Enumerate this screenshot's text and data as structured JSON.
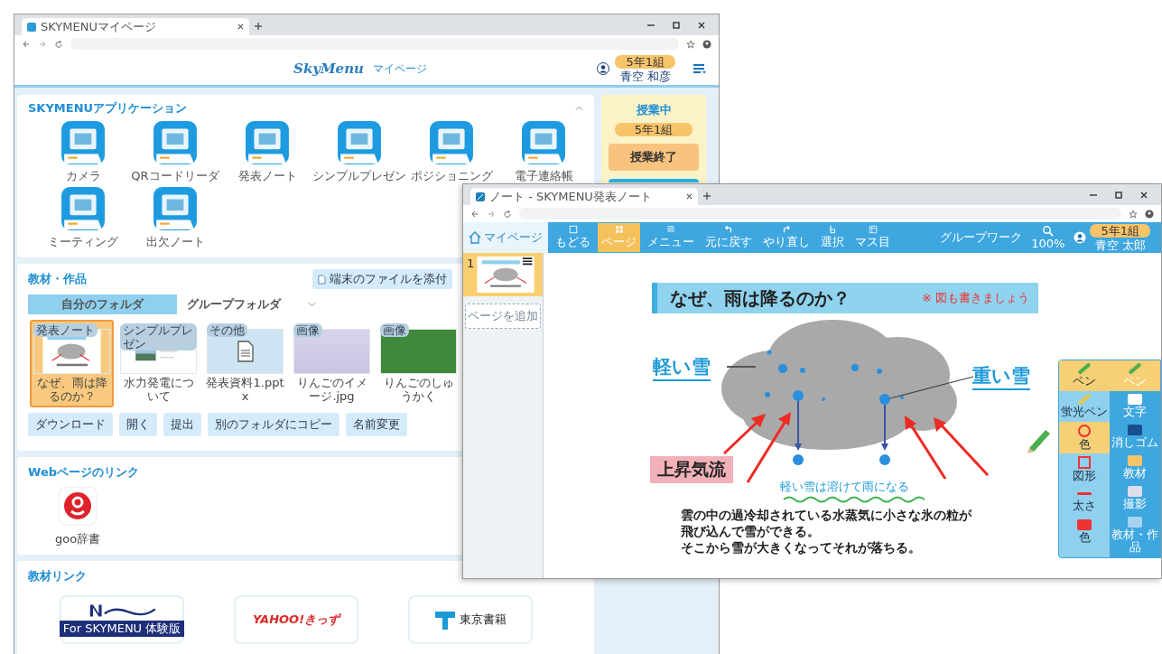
{
  "main_window": {
    "tab_title": "SKYMENUマイページ",
    "logo": "SkyMenu",
    "header_title": "マイページ",
    "class_badge": "5年1組",
    "user_name": "青空 和彦",
    "apps_section": {
      "title": "SKYMENUアプリケーション",
      "apps": [
        "カメラ",
        "QRコードリーダ",
        "発表ノート",
        "シンプルプレゼン",
        "ポジショニング",
        "電子連絡帳",
        "ミーティング",
        "出欠ノート"
      ]
    },
    "class_panel": {
      "status": "授業中",
      "class_badge": "5年1組",
      "end_button": "授業終了"
    },
    "materials": {
      "title": "教材・作品",
      "attach_button": "端末のファイルを添付",
      "folder_tabs": [
        {
          "label": "自分のフォルダ",
          "selected": true
        },
        {
          "label": "グループフォルダ",
          "selected": false
        }
      ],
      "files": [
        {
          "kind": "note",
          "tag": "発表ノート",
          "name": "なぜ、雨は降るのか？",
          "selected": true
        },
        {
          "kind": "presentation",
          "tag": "シンプルプレゼン",
          "name": "水力発電について",
          "selected": false
        },
        {
          "kind": "document",
          "tag": "その他",
          "name": "発表資料1.pptx",
          "selected": false
        },
        {
          "kind": "photo",
          "tag": "画像",
          "name": "りんごのイメージ.jpg",
          "selected": false
        },
        {
          "kind": "photo",
          "tag": "画像",
          "name": "りんごのしゅうかく",
          "selected": false
        }
      ],
      "actions": [
        "ダウンロード",
        "開く",
        "提出",
        "別のフォルダにコピー",
        "名前変更"
      ]
    },
    "web_links": {
      "title": "Webページのリンク",
      "links": [
        "goo辞書"
      ]
    },
    "material_links": {
      "title": "教材リンク",
      "links": [
        {
          "kind": "banner",
          "label": "For SKYMENU 体験版"
        },
        {
          "kind": "kids",
          "label": "YAHOO!きっず"
        },
        {
          "kind": "publisher",
          "label": "東京書籍"
        }
      ]
    }
  },
  "note_window": {
    "tab_title": "ノート - SKYMENU発表ノート",
    "home_button": "マイページ",
    "tools": [
      {
        "label": "もどる",
        "selected": false
      },
      {
        "label": "ページ",
        "selected": true
      },
      {
        "label": "メニュー",
        "selected": false
      },
      {
        "label": "元に戻す",
        "selected": false
      },
      {
        "label": "やり直し",
        "selected": false
      },
      {
        "label": "選択",
        "selected": false
      },
      {
        "label": "マス目",
        "selected": false
      }
    ],
    "group_work": "グループワーク",
    "zoom": "100%",
    "class_badge": "5年1組",
    "user_name": "青空 太郎",
    "pages": [
      {
        "number": "1",
        "selected": true
      }
    ],
    "add_page": "ページを追加",
    "slide": {
      "title": "なぜ、雨は降るのか？",
      "note": "※ 図も書きましょう",
      "light_snow": "軽い雪",
      "heavy_snow": "重い雪",
      "updraft": "上昇気流",
      "caption": "軽い雪は溶けて雨になる",
      "lines": [
        "雲の中の過冷却されている水蒸気に小さな氷の粒が",
        "飛び込んで雪ができる。",
        "そこから雪が大きくなってそれが落ちる。"
      ]
    },
    "palette": {
      "left": [
        {
          "label": "ペン",
          "selected": true
        },
        {
          "label": "蛍光ペン",
          "selected": false
        },
        {
          "label": "色",
          "selected": true
        },
        {
          "label": "図形",
          "selected": false
        },
        {
          "label": "太さ",
          "selected": false
        },
        {
          "label": "色",
          "selected": false
        }
      ],
      "right": [
        {
          "label": "ペン",
          "selected": true
        },
        {
          "label": "文字",
          "selected": false
        },
        {
          "label": "消しゴム",
          "selected": false
        },
        {
          "label": "教材",
          "selected": false
        },
        {
          "label": "撮影",
          "selected": false
        },
        {
          "label": "教材・作品",
          "selected": false
        }
      ]
    }
  }
}
